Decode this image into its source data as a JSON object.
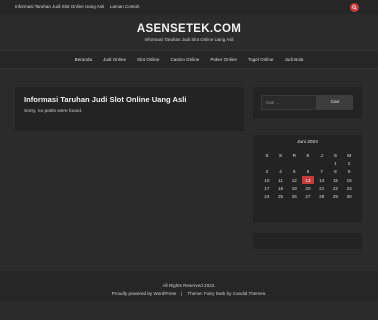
{
  "topbar": {
    "links": [
      "Informasi Taruhan Judi Slot Online Uang Asli",
      "Laman Contoh"
    ],
    "search_icon": "search-icon",
    "accent": "#c83a3a"
  },
  "header": {
    "title": "ASENSETEK.COM",
    "description": "Informasi Taruhan Judi Slot Online Uang Asli"
  },
  "nav": {
    "items": [
      "Beranda",
      "Judi Online",
      "Slot Online",
      "Casino Online",
      "Poker Online",
      "Togel Online",
      "Judi Bola"
    ]
  },
  "main": {
    "title": "Informasi Taruhan Judi Slot Online Uang Asli",
    "text": "Sorry, no posts were found."
  },
  "sidebar": {
    "search": {
      "placeholder": "Cari …",
      "button": "Cari"
    },
    "calendar": {
      "caption": "Juni 2024",
      "days_of_week": [
        "S",
        "S",
        "R",
        "K",
        "J",
        "S",
        "M"
      ],
      "weeks": [
        [
          "",
          "",
          "",
          "",
          "",
          "1",
          "2"
        ],
        [
          "3",
          "4",
          "5",
          "6",
          "7",
          "8",
          "9"
        ],
        [
          "10",
          "11",
          "12",
          "13",
          "14",
          "15",
          "16"
        ],
        [
          "17",
          "18",
          "19",
          "20",
          "21",
          "22",
          "23"
        ],
        [
          "24",
          "25",
          "26",
          "27",
          "28",
          "29",
          "30"
        ]
      ],
      "today": "13"
    }
  },
  "footer": {
    "copyright": "All Rights Reserved 2022.",
    "powered": "Proudly powered by WordPress",
    "separator": "|",
    "theme": "Theme: Fairy Dark by",
    "author": "Candid Themes."
  }
}
